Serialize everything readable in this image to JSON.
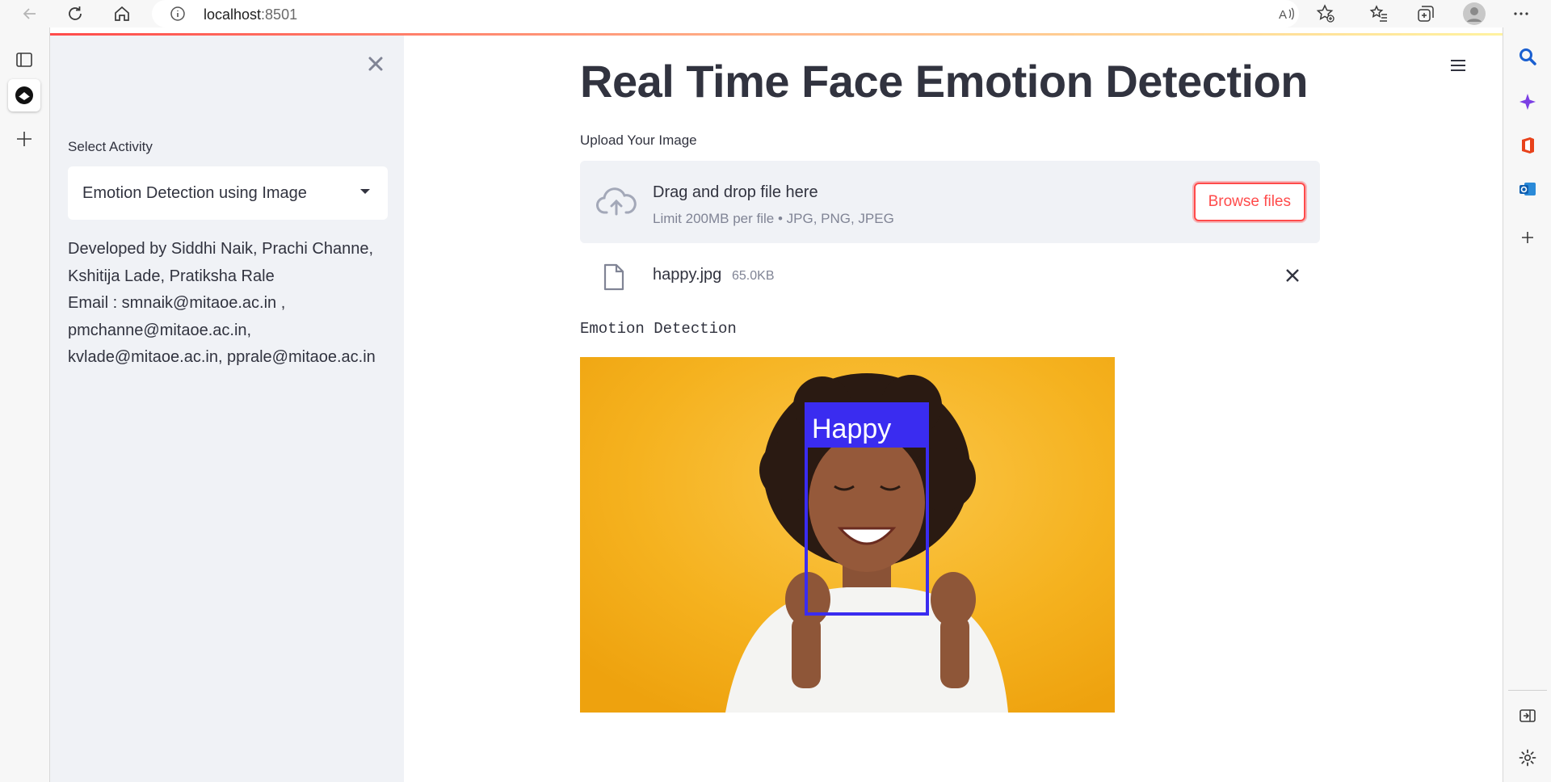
{
  "browser": {
    "url_host": "localhost",
    "url_port": ":8501"
  },
  "sidebar": {
    "select_label": "Select Activity",
    "select_value": "Emotion Detection using Image",
    "info_lines": [
      "Developed by Siddhi Naik, Prachi Channe,",
      "Kshitija Lade, Pratiksha Rale",
      "Email : smnaik@mitaoe.ac.in ,",
      "pmchanne@mitaoe.ac.in,",
      "kvlade@mitaoe.ac.in, pprale@mitaoe.ac.in"
    ]
  },
  "main": {
    "title": "Real Time Face Emotion Detection",
    "upload_label": "Upload Your Image",
    "dropzone": {
      "main_text": "Drag and drop file here",
      "sub_text": "Limit 200MB per file • JPG, PNG, JPEG",
      "browse_label": "Browse files"
    },
    "file": {
      "name": "happy.jpg",
      "size": "65.0KB"
    },
    "result_label": "Emotion Detection",
    "detection": {
      "emotion": "Happy",
      "box_color": "#3a2cf0"
    }
  },
  "colors": {
    "accent": "#ff4b4b",
    "sidebar_bg": "#f0f2f6",
    "text": "#31333f",
    "photo_bg": "#f5b21f"
  }
}
